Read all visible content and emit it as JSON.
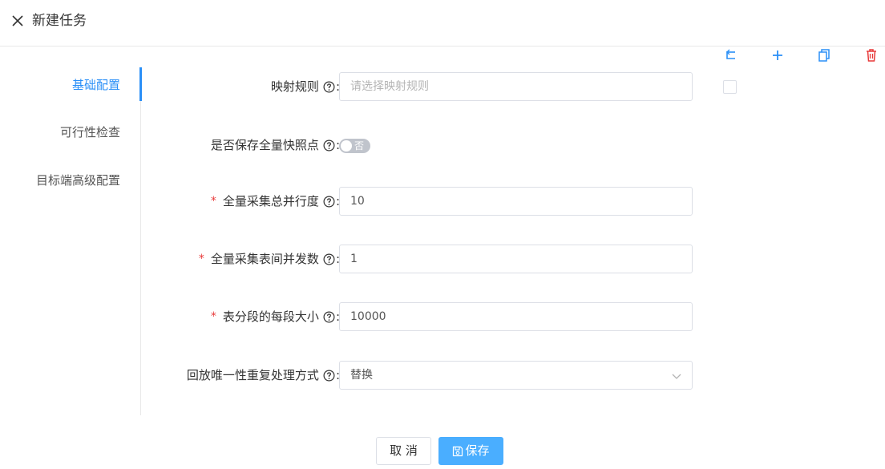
{
  "header": {
    "title": "新建任务"
  },
  "toolbar": {
    "icons": [
      "undo-icon",
      "plus-icon",
      "copy-icon",
      "delete-icon"
    ],
    "colors": {
      "primary": "#2a8ff7",
      "danger": "#e83a3a"
    }
  },
  "nav": {
    "items": [
      {
        "label": "基础配置",
        "active": true
      },
      {
        "label": "可行性检查",
        "active": false
      },
      {
        "label": "目标端高级配置",
        "active": false
      }
    ]
  },
  "form": {
    "mapping_rule": {
      "label": "映射规则",
      "placeholder": "请选择映射规则",
      "value": ""
    },
    "save_snapshot": {
      "label": "是否保存全量快照点",
      "switch_text": "否",
      "on": false
    },
    "total_parallel": {
      "label": "全量采集总并行度",
      "value": "10",
      "required": true
    },
    "table_concurrency": {
      "label": "全量采集表间并发数",
      "value": "1",
      "required": true
    },
    "segment_size": {
      "label": "表分段的每段大小",
      "value": "10000",
      "required": true
    },
    "replay_conflict": {
      "label": "回放唯一性重复处理方式",
      "value": "替换"
    },
    "colon": ":",
    "required_mark": "*"
  },
  "buttons": {
    "cancel": "取 消",
    "save": "保存"
  }
}
